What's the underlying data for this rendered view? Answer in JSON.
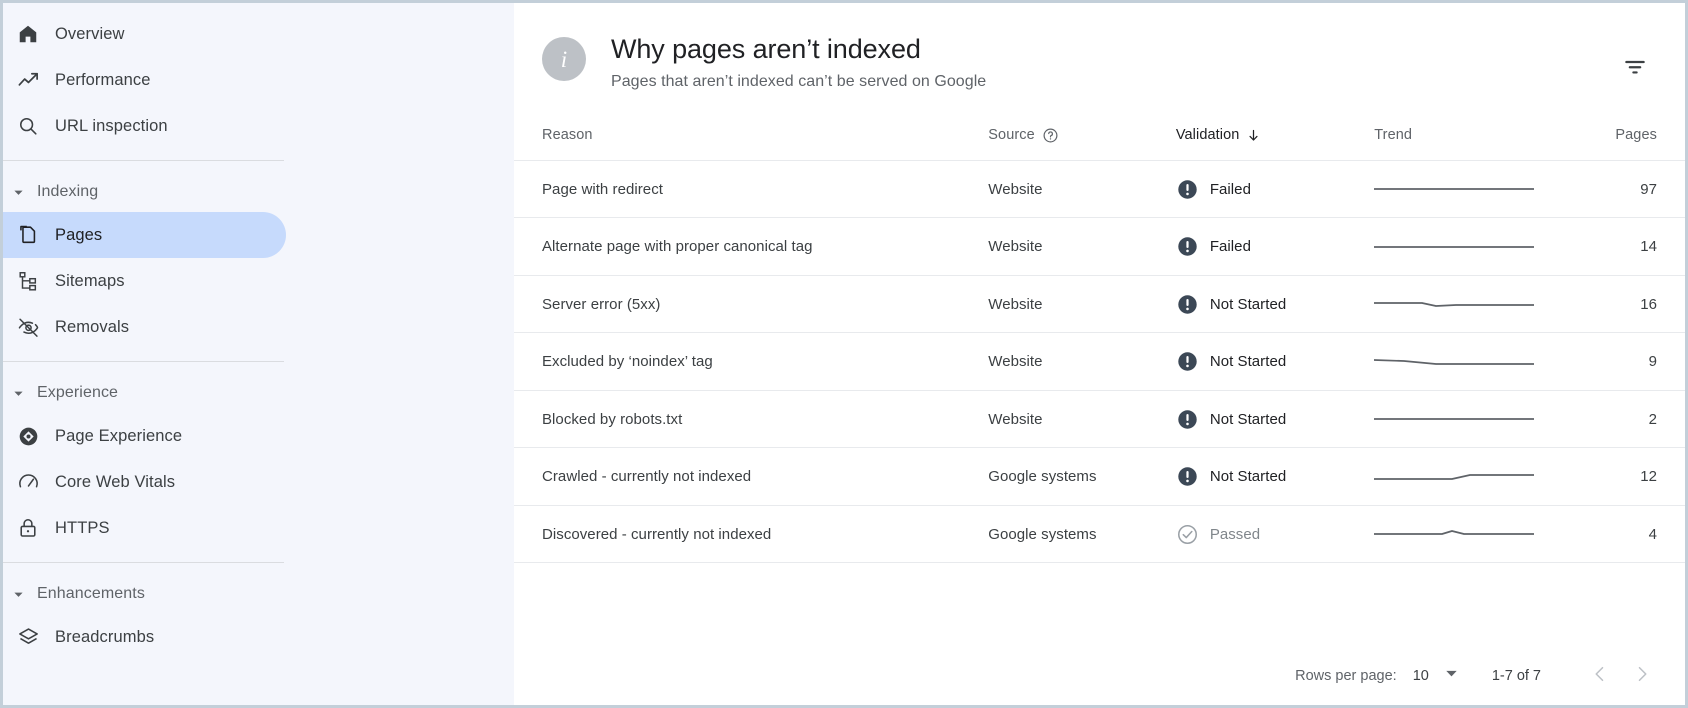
{
  "sidebar": {
    "top_items": [
      {
        "label": "Overview",
        "icon": "home-icon"
      },
      {
        "label": "Performance",
        "icon": "trending-up-icon"
      },
      {
        "label": "URL inspection",
        "icon": "search-icon"
      }
    ],
    "groups": [
      {
        "label": "Indexing",
        "items": [
          {
            "label": "Pages",
            "icon": "pages-copy-icon",
            "active": true
          },
          {
            "label": "Sitemaps",
            "icon": "sitemap-icon",
            "active": false
          },
          {
            "label": "Removals",
            "icon": "eye-off-icon",
            "active": false
          }
        ]
      },
      {
        "label": "Experience",
        "items": [
          {
            "label": "Page Experience",
            "icon": "page-experience-icon",
            "active": false
          },
          {
            "label": "Core Web Vitals",
            "icon": "speedometer-icon",
            "active": false
          },
          {
            "label": "HTTPS",
            "icon": "lock-icon",
            "active": false
          }
        ]
      },
      {
        "label": "Enhancements",
        "items": [
          {
            "label": "Breadcrumbs",
            "icon": "layers-icon",
            "active": false
          }
        ]
      }
    ]
  },
  "header": {
    "title": "Why pages aren’t indexed",
    "subtitle": "Pages that aren’t indexed can’t be served on Google",
    "info_glyph": "i",
    "filter_icon": "filter-icon"
  },
  "table": {
    "columns": {
      "reason": "Reason",
      "source": "Source",
      "validation": "Validation",
      "trend": "Trend",
      "pages": "Pages"
    },
    "sorted_by": "validation",
    "sort_direction": "desc",
    "rows": [
      {
        "reason": "Page with redirect",
        "source": "Website",
        "validation": "Failed",
        "status": "error",
        "pages": "97",
        "trend": "0,10 160,10"
      },
      {
        "reason": "Alternate page with proper canonical tag",
        "source": "Website",
        "validation": "Failed",
        "status": "error",
        "pages": "14",
        "trend": "0,10 160,10"
      },
      {
        "reason": "Server error (5xx)",
        "source": "Website",
        "validation": "Not Started",
        "status": "error",
        "pages": "16",
        "trend": "0,9 48,9 62,12 82,11 160,11"
      },
      {
        "reason": "Excluded by ‘noindex’ tag",
        "source": "Website",
        "validation": "Not Started",
        "status": "error",
        "pages": "9",
        "trend": "0,8 30,9 62,12 100,12 160,12"
      },
      {
        "reason": "Blocked by robots.txt",
        "source": "Website",
        "validation": "Not Started",
        "status": "error",
        "pages": "2",
        "trend": "0,10 160,10"
      },
      {
        "reason": "Crawled - currently not indexed",
        "source": "Google systems",
        "validation": "Not Started",
        "status": "error",
        "pages": "12",
        "trend": "0,12 78,12 96,8 160,8"
      },
      {
        "reason": "Discovered - currently not indexed",
        "source": "Google systems",
        "validation": "Passed",
        "status": "passed",
        "pages": "4",
        "trend": "0,10 68,10 78,7 90,10 160,10"
      }
    ]
  },
  "footer": {
    "rows_per_page_label": "Rows per page:",
    "rows_per_page_value": "10",
    "range_label": "1-7 of 7",
    "prev_icon": "chevron-left-icon",
    "next_icon": "chevron-right-icon",
    "dropdown_icon": "caret-down-icon"
  },
  "colors": {
    "sidebar_bg": "#f4f6fc",
    "active_item_bg": "#c6dafc",
    "error_icon": "#3c4856",
    "passed_icon": "#9aa0a6",
    "text_primary": "#202124",
    "text_secondary": "#5f6368",
    "border": "#e8eaed",
    "frame": "#c3cfd9"
  }
}
